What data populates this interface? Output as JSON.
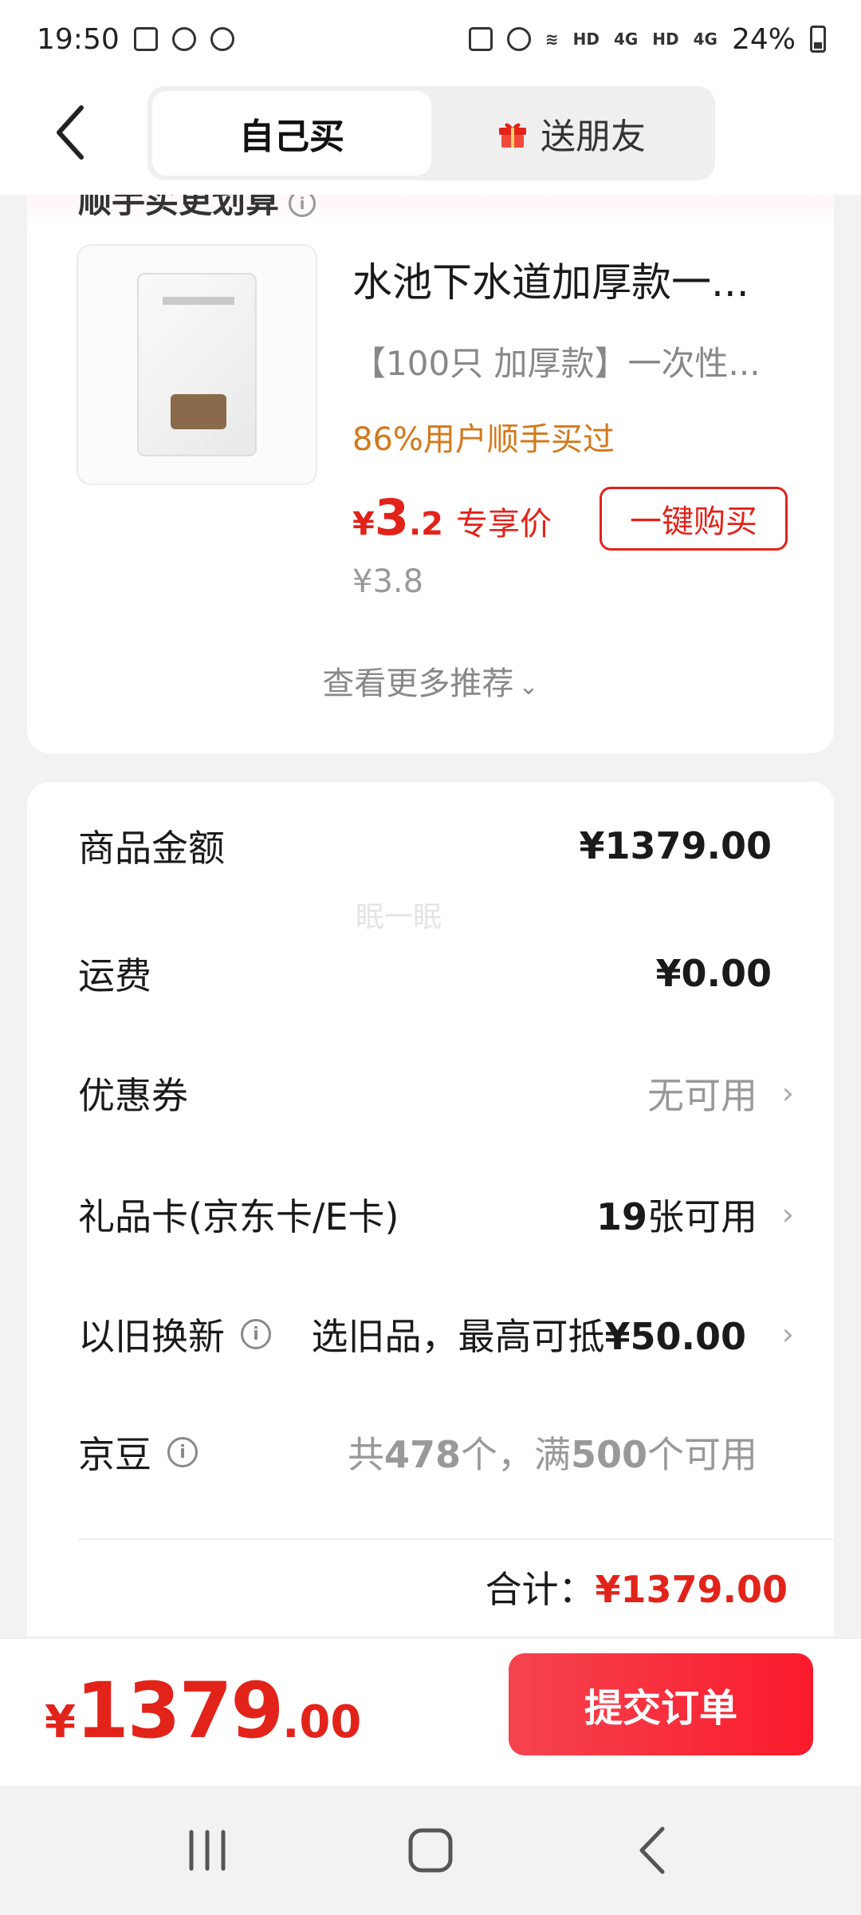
{
  "status_bar": {
    "time": "19:50",
    "signal_labels": [
      "HD",
      "4G",
      "HD",
      "4G"
    ],
    "battery": "24%"
  },
  "header": {
    "tabs": [
      {
        "label": "自己买",
        "active": true
      },
      {
        "label": "送朋友",
        "active": false
      }
    ]
  },
  "recommend": {
    "title": "顺手买更划算",
    "product": {
      "name": "水池下水道加厚款一...",
      "spec": "【100只 加厚款】一次性...",
      "tag": "86%用户顺手买过",
      "price_yen": "¥",
      "price_int": "3",
      "price_dec": ".2",
      "price_label": "专享价",
      "orig_price": "¥3.8",
      "buy_label": "一键购买"
    },
    "more_label": "查看更多推荐"
  },
  "summary": {
    "watermark": "眠一眠",
    "rows": [
      {
        "label": "商品金额",
        "value": "¥1379.00"
      },
      {
        "label": "运费",
        "value": "¥0.00"
      },
      {
        "label": "优惠券",
        "value": "无可用"
      },
      {
        "label": "礼品卡(京东卡/E卡)",
        "value_num": "19",
        "value_text": "张可用"
      },
      {
        "label": "以旧换新",
        "value_text": "选旧品，最高可抵",
        "value_num": "¥50.00"
      },
      {
        "label": "京豆",
        "value_pre": "共",
        "value_num1": "478",
        "value_mid": "个，满",
        "value_num2": "500",
        "value_post": "个可用"
      }
    ],
    "total_label": "合计：",
    "total_value": "¥1379.00"
  },
  "bottom_bar": {
    "price_yen": "¥",
    "price_int": "1379",
    "price_dec": ".00",
    "submit_label": "提交订单"
  },
  "colors": {
    "accent": "#e2231a",
    "tag_orange": "#d4781b",
    "submit_gradient": [
      "#f5444f",
      "#fa1b2c"
    ]
  }
}
